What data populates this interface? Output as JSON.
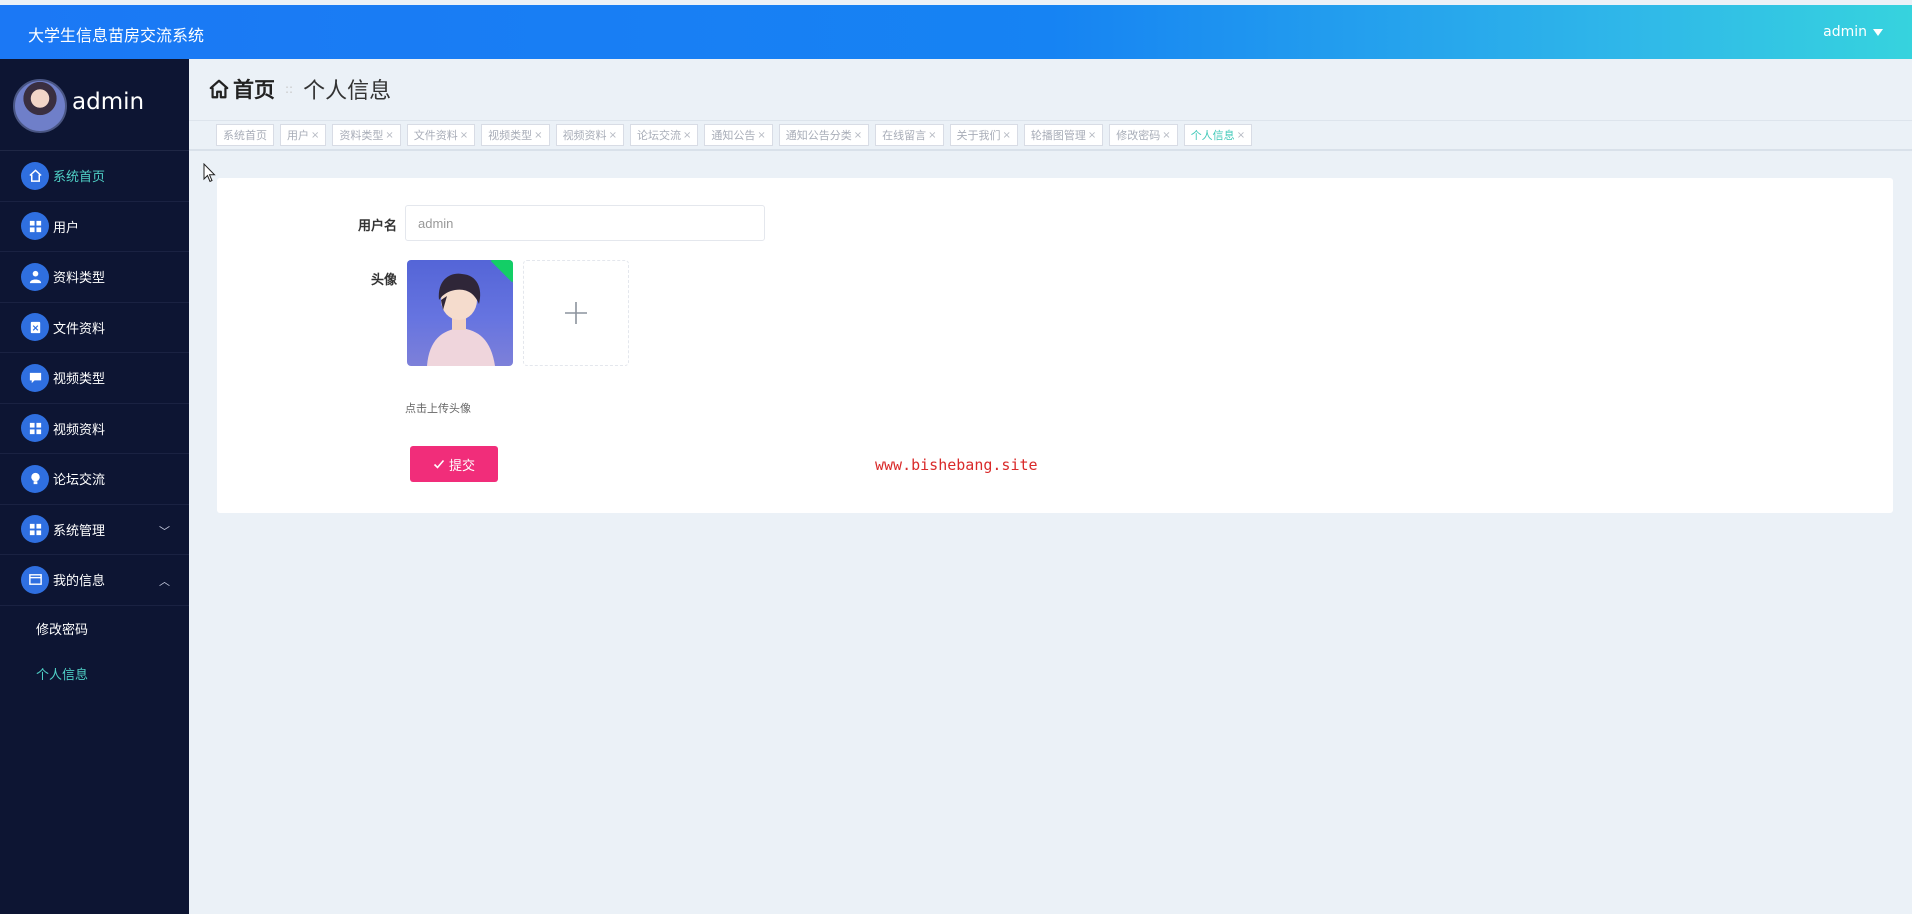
{
  "header": {
    "app_title": "大学生信息苗房交流系统",
    "user_menu": "admin"
  },
  "sidebar": {
    "username": "admin",
    "items": [
      {
        "label": "系统首页",
        "icon": "home-icon",
        "active": true
      },
      {
        "label": "用户",
        "icon": "grid-icon"
      },
      {
        "label": "资料类型",
        "icon": "user-icon"
      },
      {
        "label": "文件资料",
        "icon": "file-icon"
      },
      {
        "label": "视频类型",
        "icon": "comment-icon"
      },
      {
        "label": "视频资料",
        "icon": "grid-icon"
      },
      {
        "label": "论坛交流",
        "icon": "bulb-icon"
      },
      {
        "label": "系统管理",
        "icon": "grid-icon",
        "chevron": "﹀"
      },
      {
        "label": "我的信息",
        "icon": "window-icon",
        "chevron": "︿"
      }
    ],
    "submenu": [
      {
        "label": "修改密码"
      },
      {
        "label": "个人信息",
        "active": true
      }
    ]
  },
  "breadcrumb": {
    "home": "首页",
    "separator": "::",
    "current": "个人信息"
  },
  "tabs": [
    {
      "label": "系统首页",
      "closable": false
    },
    {
      "label": "用户",
      "closable": true
    },
    {
      "label": "资料类型",
      "closable": true
    },
    {
      "label": "文件资料",
      "closable": true
    },
    {
      "label": "视频类型",
      "closable": true
    },
    {
      "label": "视频资料",
      "closable": true
    },
    {
      "label": "论坛交流",
      "closable": true
    },
    {
      "label": "通知公告",
      "closable": true
    },
    {
      "label": "通知公告分类",
      "closable": true
    },
    {
      "label": "在线留言",
      "closable": true
    },
    {
      "label": "关于我们",
      "closable": true
    },
    {
      "label": "轮播图管理",
      "closable": true
    },
    {
      "label": "修改密码",
      "closable": true
    },
    {
      "label": "个人信息",
      "closable": true,
      "active": true
    }
  ],
  "form": {
    "username_label": "用户名",
    "username_value": "admin",
    "avatar_label": "头像",
    "upload_hint": "点击上传头像",
    "submit_label": "提交"
  },
  "watermark": "www.bishebang.site",
  "colors": {
    "accent": "#1b78f5",
    "sidebar_bg": "#0d1533",
    "active_text": "#4fd0c6",
    "submit": "#f12d7a"
  }
}
